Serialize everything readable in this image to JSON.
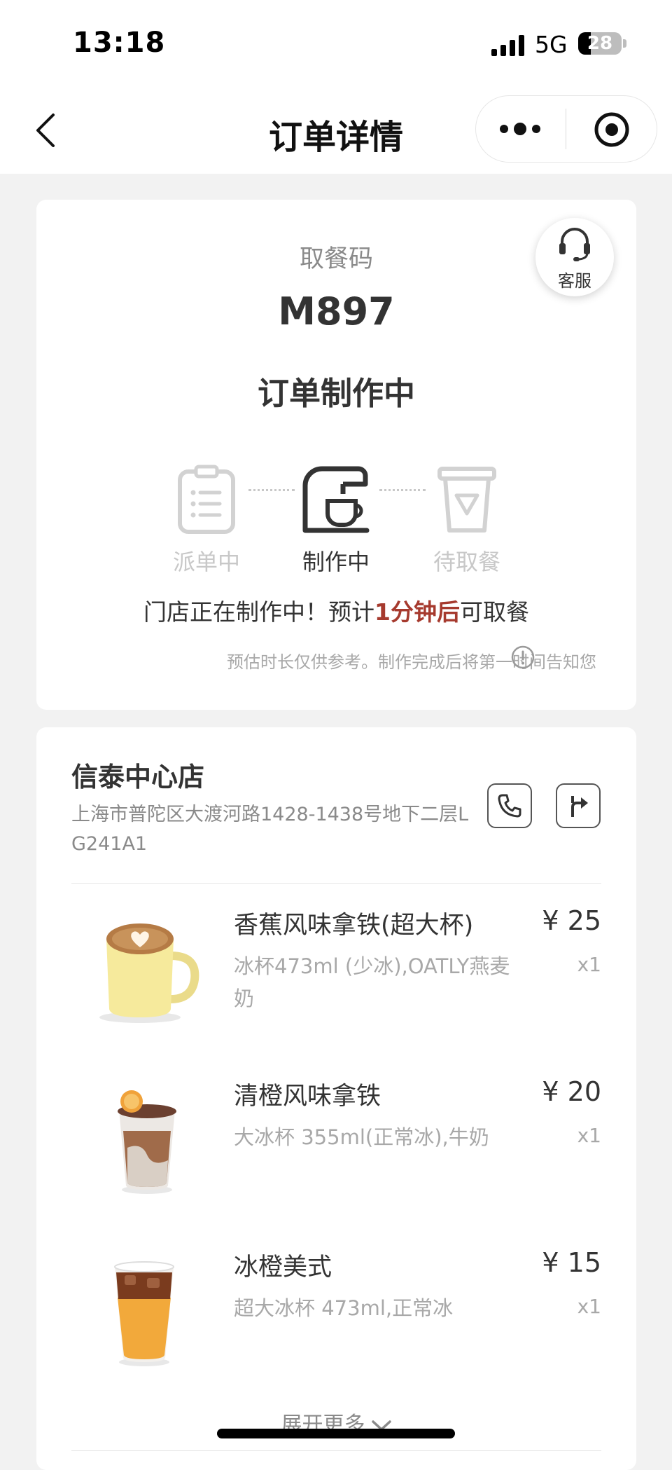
{
  "status_bar": {
    "time": "13:18",
    "network": "5G",
    "battery": "28"
  },
  "nav": {
    "title": "订单详情",
    "back_icon": "chevron-left-icon",
    "more_icon": "more-dots-icon",
    "close_icon": "target-circle-icon"
  },
  "pickup": {
    "label": "取餐码",
    "code": "M897",
    "status": "订单制作中",
    "customer_service": "客服",
    "steps": [
      {
        "label": "派单中",
        "icon": "clipboard-list-icon",
        "active": false
      },
      {
        "label": "制作中",
        "icon": "coffee-machine-icon",
        "active": true
      },
      {
        "label": "待取餐",
        "icon": "takeaway-cup-icon",
        "active": false
      }
    ],
    "message": {
      "before": "门店正在制作中！预计",
      "highlight": "1分钟后",
      "after": "可取餐"
    },
    "note": "预估时长仅供参考。制作完成后将第一时间告知您",
    "colors": {
      "highlight": "#a63a2e",
      "inactive": "#c8c8c8",
      "active": "#333333"
    }
  },
  "store": {
    "name": "信泰中心店",
    "address": "上海市普陀区大渡河路1428-1438号地下二层LG241A1",
    "phone_icon": "phone-icon",
    "navigate_icon": "navigation-arrow-icon"
  },
  "items": [
    {
      "name": "香蕉风味拿铁(超大杯)",
      "spec": "冰杯473ml (少冰),OATLY燕麦奶",
      "price": "¥ 25",
      "qty": "x1"
    },
    {
      "name": "清橙风味拿铁",
      "spec": "大冰杯 355ml(正常冰),牛奶",
      "price": "¥ 20",
      "qty": "x1"
    },
    {
      "name": "冰橙美式",
      "spec": "超大冰杯 473ml,正常冰",
      "price": "¥ 15",
      "qty": "x1"
    }
  ],
  "expand_more": "展开更多"
}
